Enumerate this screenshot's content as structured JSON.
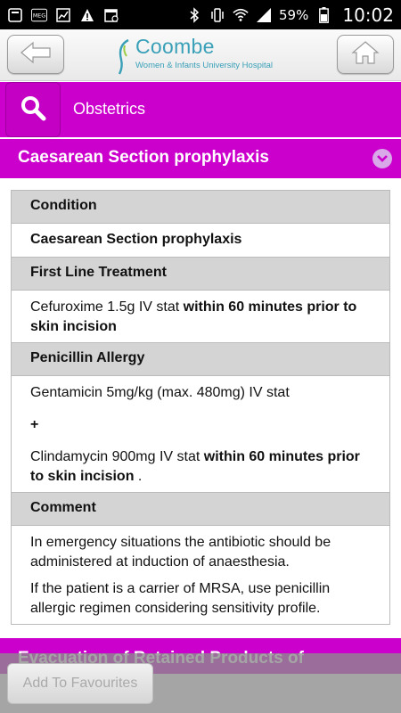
{
  "status_bar": {
    "icons": [
      "notification-icon",
      "meg-icon",
      "chart-icon",
      "warning-icon",
      "calendar-icon",
      "bluetooth-icon",
      "vibrate-icon",
      "wifi-icon",
      "signal-icon",
      "battery-icon"
    ],
    "meg_label": "MEG",
    "battery_percent": "59%",
    "time": "10:02"
  },
  "header": {
    "logo_name": "Coombe",
    "logo_subtitle": "Women & Infants University Hospital",
    "back_icon": "back-arrow-icon",
    "home_icon": "home-icon"
  },
  "section": {
    "title": "Obstetrics",
    "search_icon": "search-icon"
  },
  "accordion": {
    "title": "Caesarean Section prophylaxis",
    "toggle_icon": "chevron-down-icon",
    "rows": {
      "condition_label": "Condition",
      "condition_value": "Caesarean Section prophylaxis",
      "first_line_label": "First Line Treatment",
      "first_line_text": "Cefuroxime 1.5g IV stat ",
      "first_line_bold": "within 60 minutes prior to skin incision",
      "allergy_label": "Penicillin Allergy",
      "allergy_line1": "Gentamicin 5mg/kg (max. 480mg) IV stat",
      "allergy_plus": "+",
      "allergy_line2_text": "Clindamycin 900mg IV stat ",
      "allergy_line2_bold": "within 60 minutes prior to skin incision",
      "allergy_line2_end": " .",
      "comment_label": "Comment",
      "comment_para1": "In emergency situations the antibiotic should be administered at induction of anaesthesia.",
      "comment_para2": "If the patient is a carrier of MRSA, use penicillin allergic regimen considering sensitivity profile."
    }
  },
  "next_accordion": {
    "title": "Evacuation of Retained Products of"
  },
  "bottom_bar": {
    "fav_label": "Add To Favourites"
  },
  "colors": {
    "magenta": "#cc00cc",
    "header_row": "#d4d4d4",
    "logo": "#3aa0b8"
  }
}
